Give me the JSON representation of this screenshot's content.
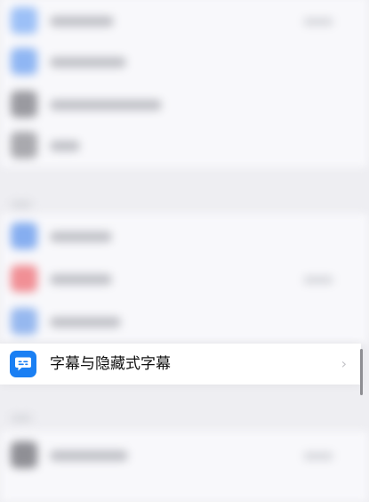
{
  "highlighted_row": {
    "label": "字幕与隐藏式字幕",
    "icon": "captions-bubble-icon",
    "accessory": "chevron-right-icon",
    "accessory_glyph": "›",
    "icon_color": "#1a7ff3"
  },
  "blurred_rows": [
    {
      "name": "blurred-row-1",
      "icon_color": "#9cc0f7"
    },
    {
      "name": "blurred-row-2",
      "icon_color": "#8fb6f3"
    },
    {
      "name": "blurred-row-3",
      "icon_color": "#9a9aa0"
    },
    {
      "name": "blurred-row-4",
      "icon_color": "#a9a9ae"
    },
    {
      "name": "blurred-row-5",
      "icon_color": "#86aef0"
    },
    {
      "name": "blurred-row-6",
      "icon_color": "#f18f95"
    },
    {
      "name": "blurred-row-7",
      "icon_color": "#96b8ef"
    },
    {
      "name": "blurred-row-8",
      "icon_color": "#8f8f95"
    }
  ]
}
